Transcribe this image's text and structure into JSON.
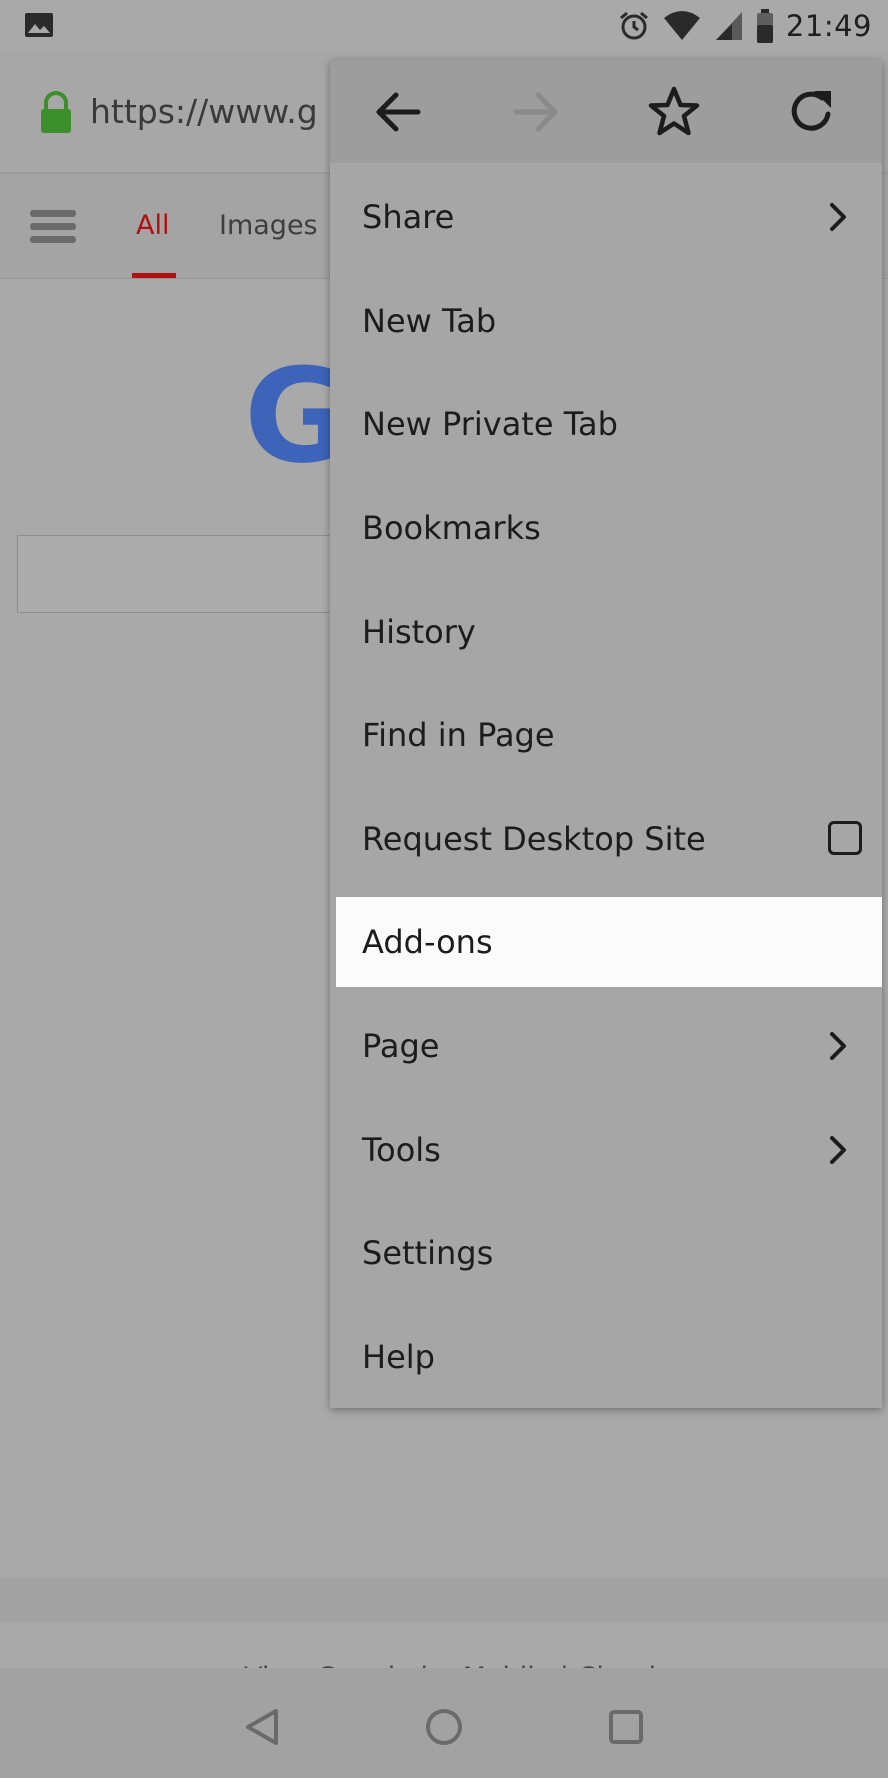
{
  "status_bar": {
    "time": "21:49",
    "icons": [
      "gallery-icon",
      "alarm-icon",
      "wifi-icon",
      "signal-icon",
      "battery-icon"
    ]
  },
  "browser": {
    "url": "https://www.g",
    "secure_icon": "lock-icon"
  },
  "page": {
    "tabs": [
      {
        "label": "All",
        "active": true
      },
      {
        "label": "Images",
        "active": false
      }
    ],
    "logo_letter": "G",
    "footer": "View Google in: Mobile | Classic"
  },
  "menu": {
    "header_icons": [
      "back-arrow-icon",
      "forward-arrow-icon",
      "star-icon",
      "reload-icon"
    ],
    "items": [
      {
        "label": "Share",
        "submenu": true
      },
      {
        "label": "New Tab"
      },
      {
        "label": "New Private Tab"
      },
      {
        "label": "Bookmarks"
      },
      {
        "label": "History"
      },
      {
        "label": "Find in Page"
      },
      {
        "label": "Request Desktop Site",
        "checkbox": true,
        "checked": false
      },
      {
        "label": "Add-ons",
        "highlighted": true
      },
      {
        "label": "Page",
        "submenu": true
      },
      {
        "label": "Tools",
        "submenu": true
      },
      {
        "label": "Settings"
      },
      {
        "label": "Help"
      }
    ]
  },
  "nav_bar": {
    "icons": [
      "back-triangle-icon",
      "home-circle-icon",
      "recents-square-icon"
    ]
  },
  "colors": {
    "accent_red": "#b01010",
    "google_blue": "#3d64b8",
    "lock_green": "#3c8f2a",
    "highlight": "#fbfbfb"
  }
}
